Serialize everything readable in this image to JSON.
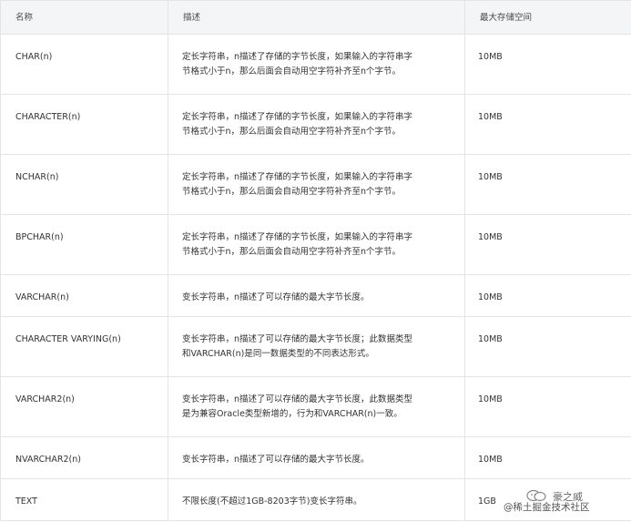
{
  "table": {
    "headers": {
      "name": "名称",
      "description": "描述",
      "max_storage": "最大存储空间"
    },
    "rows": [
      {
        "name": "CHAR(n)",
        "description_line1": "定长字符串，n描述了存储的字节长度，如果输入的字符串字",
        "description_line2": "节格式小于n，那么后面会自动用空字符补齐至n个字节。",
        "max_storage": "10MB"
      },
      {
        "name": "CHARACTER(n)",
        "description_line1": "定长字符串，n描述了存储的字节长度，如果输入的字符串字",
        "description_line2": "节格式小于n，那么后面会自动用空字符补齐至n个字节。",
        "max_storage": "10MB"
      },
      {
        "name": "NCHAR(n)",
        "description_line1": "定长字符串，n描述了存储的字节长度，如果输入的字符串字",
        "description_line2": "节格式小于n，那么后面会自动用空字符补齐至n个字节。",
        "max_storage": "10MB"
      },
      {
        "name": "BPCHAR(n)",
        "description_line1": "定长字符串，n描述了存储的字节长度，如果输入的字符串字",
        "description_line2": "节格式小于n，那么后面会自动用空字符补齐至n个字节。",
        "max_storage": "10MB"
      },
      {
        "name": "VARCHAR(n)",
        "description_line1": "变长字符串，n描述了可以存储的最大字节长度。",
        "description_line2": "",
        "max_storage": "10MB"
      },
      {
        "name": "CHARACTER VARYING(n)",
        "description_line1": "变长字符串，n描述了可以存储的最大字节长度；此数据类型",
        "description_line2": "和VARCHAR(n)是同一数据类型的不同表达形式。",
        "max_storage": "10MB"
      },
      {
        "name": "VARCHAR2(n)",
        "description_line1": "变长字符串，n描述了可以存储的最大字节长度，此数据类型",
        "description_line2": "是为兼容Oracle类型新增的，行为和VARCHAR(n)一致。",
        "max_storage": "10MB"
      },
      {
        "name": "NVARCHAR2(n)",
        "description_line1": "变长字符串，n描述了可以存储的最大字节长度。",
        "description_line2": "",
        "max_storage": "10MB"
      },
      {
        "name": "TEXT",
        "description_line1": "不限长度(不超过1GB-8203字节)变长字符串。",
        "description_line2": "",
        "max_storage": "1GB"
      }
    ]
  },
  "watermark": {
    "top_text": "豪之威",
    "bottom_text": "@稀土掘金技术社区",
    "icon": "wechat-icon"
  },
  "colors": {
    "header_bg": "#f4f5f7",
    "border": "#e4e4e4",
    "text": "#333333"
  }
}
